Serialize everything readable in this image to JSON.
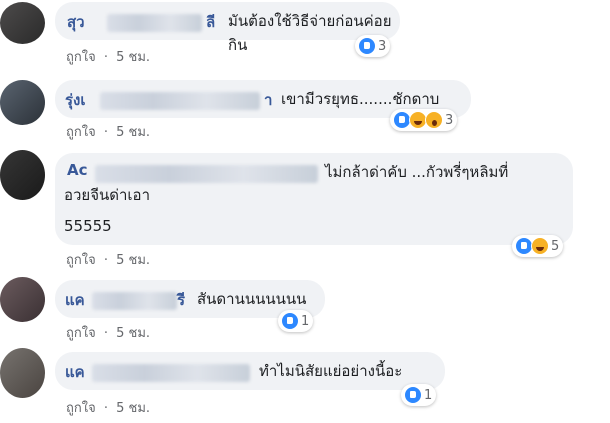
{
  "comments": [
    {
      "author_prefix": "สุว",
      "author_suffix": "ลี",
      "text": "มันต้องใช้วิธีจ่ายก่อนค่อยกิน",
      "like_label": "ถูกใจ",
      "time": "5 ชม.",
      "reaction_count": "3",
      "reactions": [
        "like-icon"
      ]
    },
    {
      "author_prefix": "รุ่งเ",
      "author_suffix": "า",
      "text": "เขามีวรยุทธ.......ชักดาบ",
      "like_label": "ถูกใจ",
      "time": "5 ชม.",
      "reaction_count": "3",
      "reactions": [
        "like-icon",
        "haha-icon",
        "wow-icon"
      ]
    },
    {
      "author_prefix": "Ac",
      "author_suffix": "",
      "text_line1": "ไม่กล้าด่าคับ ...กัวพรี่ๆหลิมที่",
      "text_line2": "อวยจีนด่าเอา",
      "text_line3": "55555",
      "like_label": "ถูกใจ",
      "time": "5 ชม.",
      "reaction_count": "5",
      "reactions": [
        "like-icon",
        "haha-icon"
      ]
    },
    {
      "author_prefix": "แค",
      "author_suffix": "รี",
      "text": "สันดานนนนนนน",
      "like_label": "ถูกใจ",
      "time": "5 ชม.",
      "reaction_count": "1",
      "reactions": [
        "like-icon"
      ]
    },
    {
      "author_prefix": "แค",
      "author_suffix": "",
      "text": "ทำไมนิสัยแย่อย่างนี้อะ",
      "like_label": "ถูกใจ",
      "time": "5 ชม.",
      "reaction_count": "1",
      "reactions": [
        "like-icon"
      ]
    }
  ],
  "meta_separator": "·"
}
